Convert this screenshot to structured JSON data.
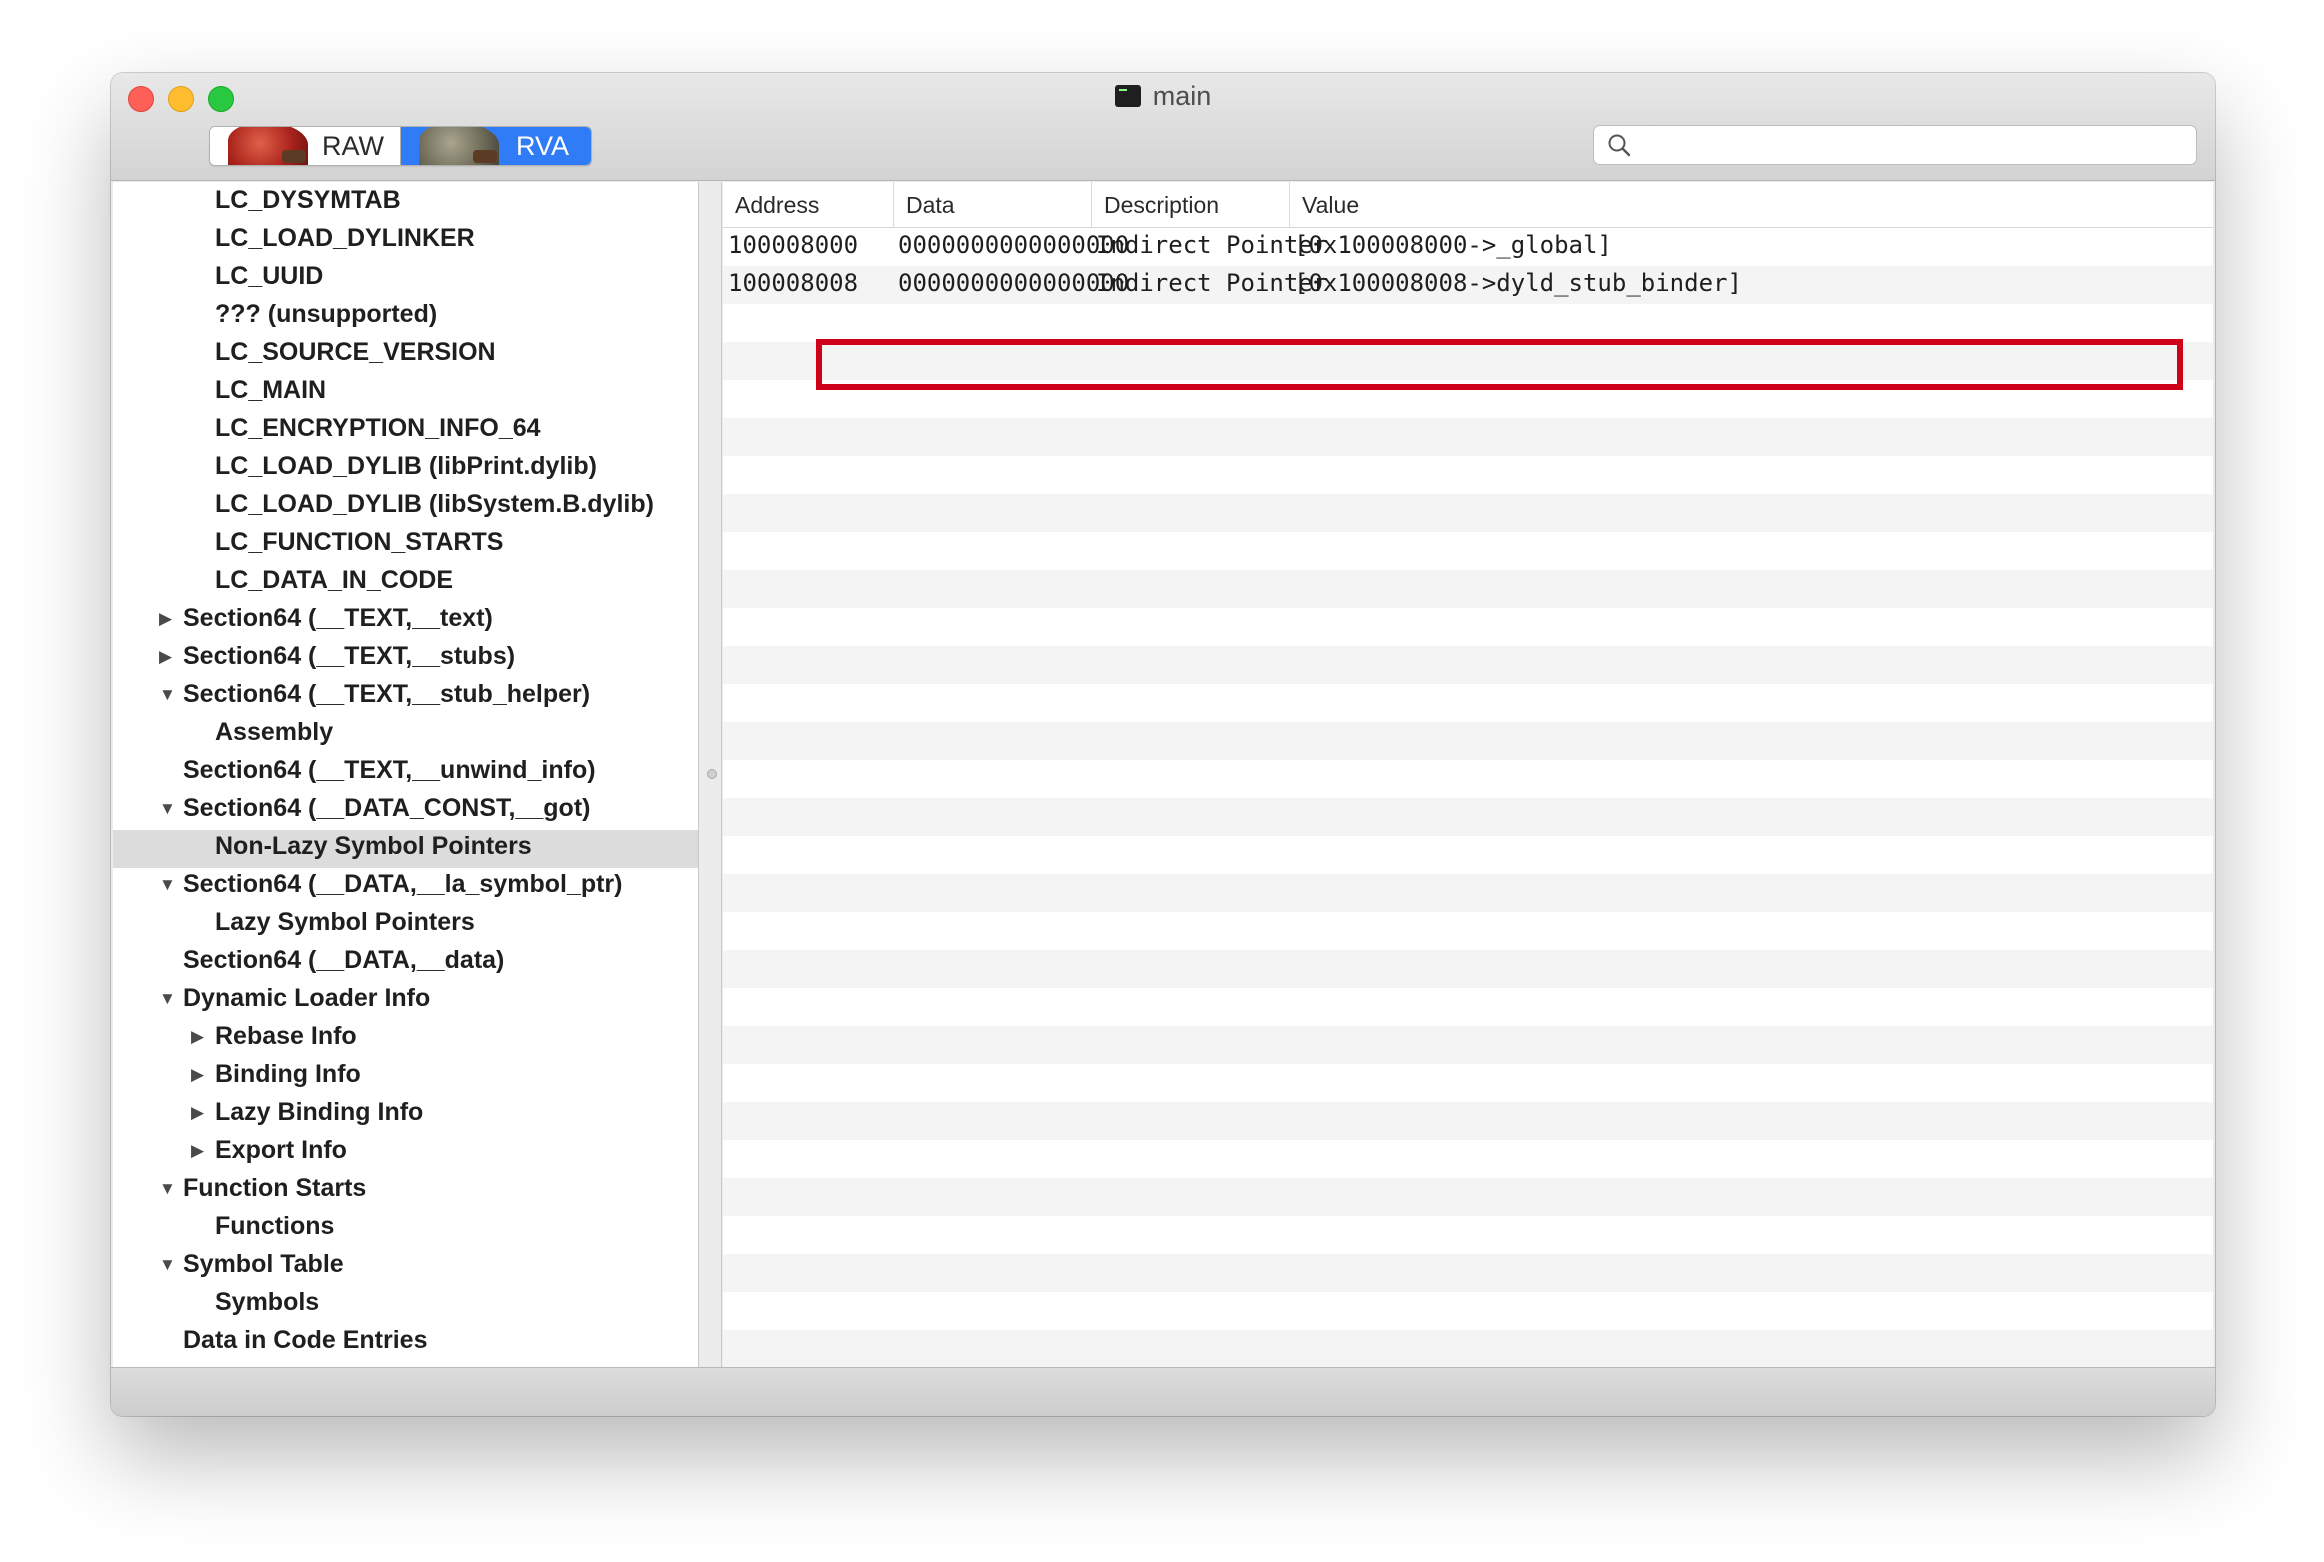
{
  "window": {
    "title": "main"
  },
  "toolbar": {
    "segments": [
      {
        "label": "RAW",
        "selected": false
      },
      {
        "label": "RVA",
        "selected": true
      }
    ],
    "search": {
      "value": "",
      "placeholder": ""
    }
  },
  "colors": {
    "accent": "#2f7cf6",
    "highlight_box": "#d0021b"
  },
  "sidebar": {
    "items": [
      {
        "label": "LC_DYSYMTAB",
        "level": 2,
        "disclosure": "none",
        "selected": false
      },
      {
        "label": "LC_LOAD_DYLINKER",
        "level": 2,
        "disclosure": "none",
        "selected": false
      },
      {
        "label": "LC_UUID",
        "level": 2,
        "disclosure": "none",
        "selected": false
      },
      {
        "label": "??? (unsupported)",
        "level": 2,
        "disclosure": "none",
        "selected": false
      },
      {
        "label": "LC_SOURCE_VERSION",
        "level": 2,
        "disclosure": "none",
        "selected": false
      },
      {
        "label": "LC_MAIN",
        "level": 2,
        "disclosure": "none",
        "selected": false
      },
      {
        "label": "LC_ENCRYPTION_INFO_64",
        "level": 2,
        "disclosure": "none",
        "selected": false
      },
      {
        "label": "LC_LOAD_DYLIB (libPrint.dylib)",
        "level": 2,
        "disclosure": "none",
        "selected": false
      },
      {
        "label": "LC_LOAD_DYLIB (libSystem.B.dylib)",
        "level": 2,
        "disclosure": "none",
        "selected": false
      },
      {
        "label": "LC_FUNCTION_STARTS",
        "level": 2,
        "disclosure": "none",
        "selected": false
      },
      {
        "label": "LC_DATA_IN_CODE",
        "level": 2,
        "disclosure": "none",
        "selected": false
      },
      {
        "label": "Section64 (__TEXT,__text)",
        "level": 1,
        "disclosure": "collapsed",
        "selected": false
      },
      {
        "label": "Section64 (__TEXT,__stubs)",
        "level": 1,
        "disclosure": "collapsed",
        "selected": false
      },
      {
        "label": "Section64 (__TEXT,__stub_helper)",
        "level": 1,
        "disclosure": "expanded",
        "selected": false
      },
      {
        "label": "Assembly",
        "level": 2,
        "disclosure": "none",
        "selected": false
      },
      {
        "label": "Section64 (__TEXT,__unwind_info)",
        "level": 1,
        "disclosure": "none",
        "selected": false
      },
      {
        "label": "Section64 (__DATA_CONST,__got)",
        "level": 1,
        "disclosure": "expanded",
        "selected": false
      },
      {
        "label": "Non-Lazy Symbol Pointers",
        "level": 2,
        "disclosure": "none",
        "selected": true
      },
      {
        "label": "Section64 (__DATA,__la_symbol_ptr)",
        "level": 1,
        "disclosure": "expanded",
        "selected": false
      },
      {
        "label": "Lazy Symbol Pointers",
        "level": 2,
        "disclosure": "none",
        "selected": false
      },
      {
        "label": "Section64 (__DATA,__data)",
        "level": 1,
        "disclosure": "none",
        "selected": false
      },
      {
        "label": "Dynamic Loader Info",
        "level": 1,
        "disclosure": "expanded",
        "selected": false
      },
      {
        "label": "Rebase Info",
        "level": 2,
        "disclosure": "collapsed",
        "selected": false
      },
      {
        "label": "Binding Info",
        "level": 2,
        "disclosure": "collapsed",
        "selected": false
      },
      {
        "label": "Lazy Binding Info",
        "level": 2,
        "disclosure": "collapsed",
        "selected": false
      },
      {
        "label": "Export Info",
        "level": 2,
        "disclosure": "collapsed",
        "selected": false
      },
      {
        "label": "Function Starts",
        "level": 1,
        "disclosure": "expanded",
        "selected": false
      },
      {
        "label": "Functions",
        "level": 2,
        "disclosure": "none",
        "selected": false
      },
      {
        "label": "Symbol Table",
        "level": 1,
        "disclosure": "expanded",
        "selected": false
      },
      {
        "label": "Symbols",
        "level": 2,
        "disclosure": "none",
        "selected": false
      },
      {
        "label": "Data in Code Entries",
        "level": 1,
        "disclosure": "none",
        "selected": false
      }
    ]
  },
  "table": {
    "columns": [
      "Address",
      "Data",
      "Description",
      "Value"
    ],
    "rows": [
      [
        "100008000",
        "0000000000000000",
        "Indirect Pointer",
        "[0x100008000->_global]"
      ],
      [
        "100008008",
        "0000000000000000",
        "Indirect Pointer",
        "[0x100008008->dyld_stub_binder]"
      ]
    ],
    "highlighted_row": 1
  }
}
